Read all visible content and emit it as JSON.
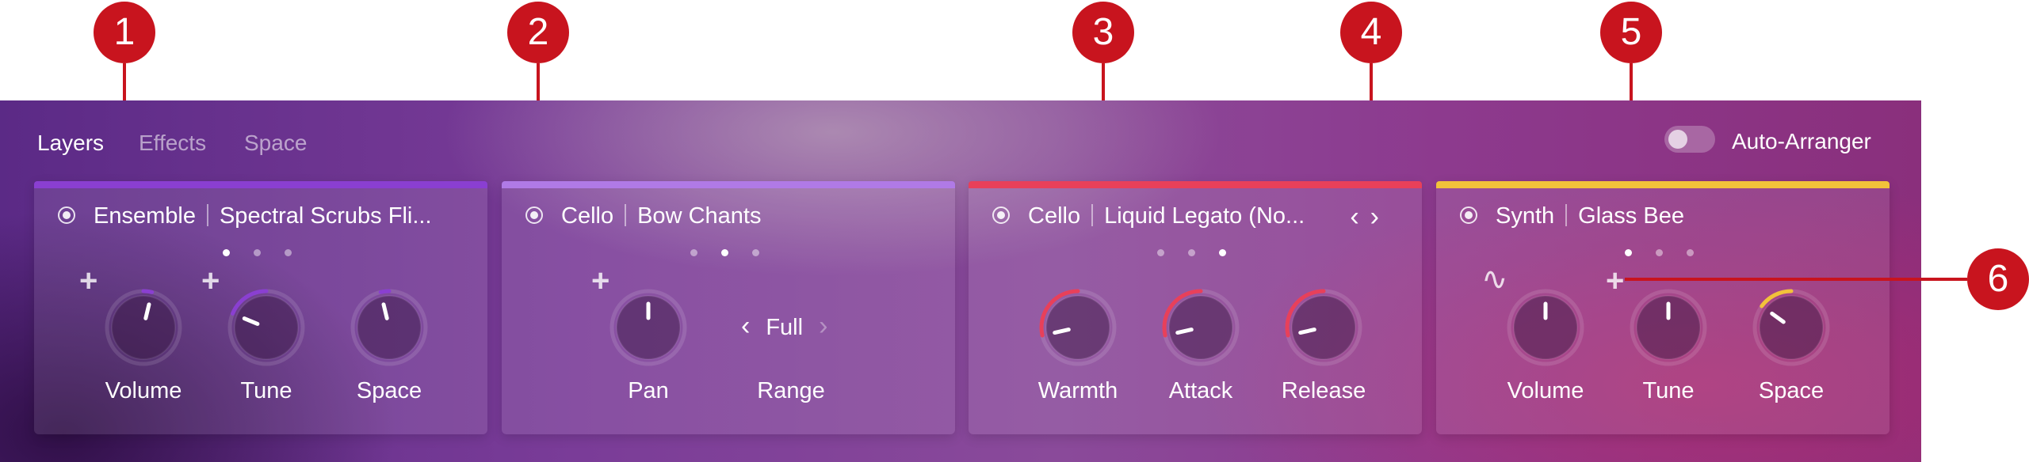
{
  "tabs": [
    {
      "label": "Layers",
      "active": true
    },
    {
      "label": "Effects",
      "active": false
    },
    {
      "label": "Space",
      "active": false
    }
  ],
  "auto_arranger": {
    "label": "Auto-Arranger",
    "on": false
  },
  "cards": [
    {
      "accent": "#8a3fd1",
      "instrument": "Ensemble",
      "preset": "Spectral Scrubs Fli...",
      "dots_active": 0,
      "knobs": [
        {
          "label": "Volume",
          "value": 0.55,
          "arc_color": "#8a3fd1",
          "plus": true
        },
        {
          "label": "Tune",
          "value": 0.25,
          "arc_color": "#8a3fd1",
          "plus": true
        },
        {
          "label": "Space",
          "value": 0.45,
          "arc_color": "#8a3fd1",
          "plus": false
        }
      ]
    },
    {
      "accent": "#b07ae6",
      "instrument": "Cello",
      "preset": "Bow Chants",
      "dots_active": 1,
      "knobs": [
        {
          "label": "Pan",
          "value": 0.5,
          "arc_color": "#b07ae6",
          "plus": true
        }
      ],
      "range": {
        "label": "Range",
        "value": "Full"
      }
    },
    {
      "accent": "#e8405a",
      "instrument": "Cello",
      "preset": "Liquid Legato (No...",
      "dots_active": 2,
      "arrows": [
        "‹",
        "›"
      ],
      "knobs": [
        {
          "label": "Warmth",
          "value": 0.12,
          "arc_color": "#e8405a",
          "plus": false
        },
        {
          "label": "Attack",
          "value": 0.12,
          "arc_color": "#e8405a",
          "plus": false
        },
        {
          "label": "Release",
          "value": 0.12,
          "arc_color": "#e8405a",
          "plus": false
        }
      ]
    },
    {
      "accent": "#f2c23a",
      "instrument": "Synth",
      "preset": "Glass Bee",
      "dots_active": 0,
      "modulation_icon": "∿",
      "knobs": [
        {
          "label": "Volume",
          "value": 0.5,
          "arc_color": "#f2c23a",
          "plus": false
        },
        {
          "label": "Tune",
          "value": 0.5,
          "arc_color": "#f2c23a",
          "plus": true
        },
        {
          "label": "Space",
          "value": 0.3,
          "arc_color": "#f2c23a",
          "plus": false
        }
      ]
    }
  ],
  "callouts": [
    "1",
    "2",
    "3",
    "4",
    "5",
    "6"
  ]
}
